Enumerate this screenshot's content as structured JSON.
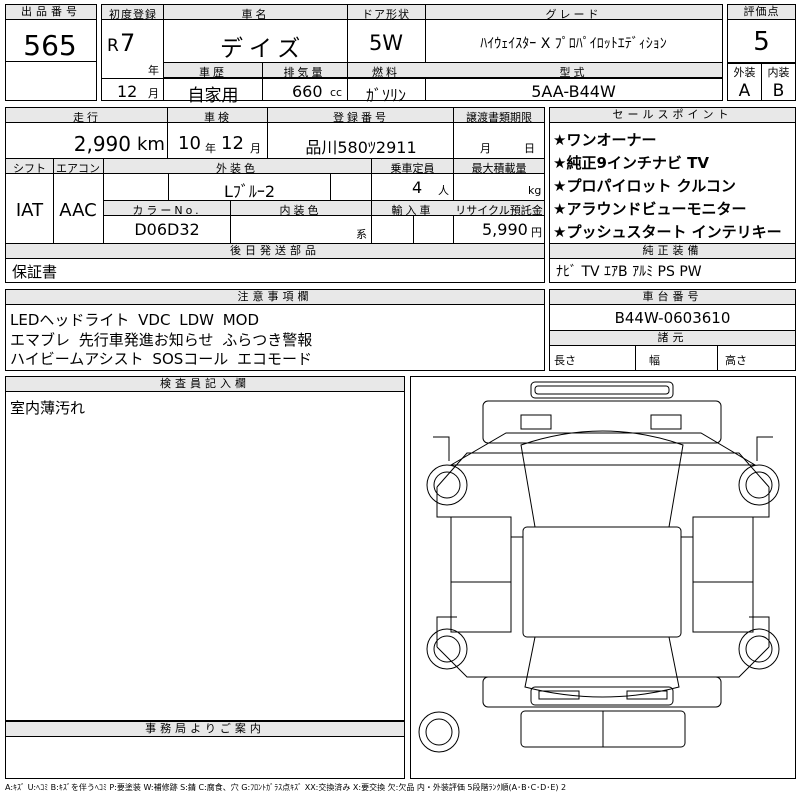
{
  "lot": {
    "label": "出品番号",
    "value": "565"
  },
  "first_reg": {
    "label": "初度登録",
    "era": "R",
    "year": "7",
    "year_unit": "年",
    "month": "12",
    "month_unit": "月"
  },
  "car_name": {
    "label": "車名",
    "value": "デイズ"
  },
  "door": {
    "label": "ドア形状",
    "value": "5W"
  },
  "grade": {
    "label": "グレード",
    "value": "ﾊｲｳｪｲｽﾀｰ X ﾌﾟﾛﾊﾟｲﾛｯﾄｴﾃﾞｨｼｮﾝ"
  },
  "score": {
    "label": "評価点",
    "value": "5"
  },
  "history": {
    "label": "車歴",
    "value": "自家用"
  },
  "displacement": {
    "label": "排気量",
    "value": "660",
    "unit": "cc"
  },
  "fuel": {
    "label": "燃料",
    "value": "ｶﾞｿﾘﾝ"
  },
  "model_code": {
    "label": "型式",
    "value": "5AA-B44W"
  },
  "exterior_score": {
    "label": "外装",
    "value": "A"
  },
  "interior_score": {
    "label": "内装",
    "value": "B"
  },
  "mileage": {
    "label": "走行",
    "value": "2,990",
    "unit": "km"
  },
  "inspection": {
    "label": "車検",
    "year": "10",
    "year_unit": "年",
    "month": "12",
    "month_unit": "月"
  },
  "plate": {
    "label": "登録番号",
    "value": "品川580ﾂ2911"
  },
  "transfer_deadline": {
    "label": "譲渡書類期限",
    "month_unit": "月",
    "day_unit": "日"
  },
  "shift": {
    "label": "シフト",
    "value": "IAT"
  },
  "aircon": {
    "label": "エアコン",
    "value": "AAC"
  },
  "exterior_color": {
    "label": "外装色",
    "value": "Lﾌﾞﾙｰ2"
  },
  "capacity": {
    "label": "乗車定員",
    "value": "4",
    "unit": "人"
  },
  "max_load": {
    "label": "最大積載量",
    "unit": "kg"
  },
  "color_no": {
    "label": "カラーNo.",
    "value": "D06D32"
  },
  "interior_color": {
    "label": "内装色",
    "unit": "系"
  },
  "import": {
    "label": "輸入車"
  },
  "recycle": {
    "label": "リサイクル預託金",
    "value": "5,990",
    "unit": "円"
  },
  "sales_points": {
    "label": "セールスポイント",
    "items": [
      "★ワンオーナー",
      "★純正9インチナビ TV",
      "★プロパイロット クルコン",
      "★アラウンドビューモニター",
      "★プッシュスタート インテリキー"
    ]
  },
  "later_parts": {
    "label": "後日発送部品",
    "value": "保証書"
  },
  "equipment": {
    "label": "純正装備",
    "value": "ﾅﾋﾞ TV ｴｱB ｱﾙﾐ PS PW"
  },
  "notes": {
    "label": "注意事項欄",
    "lines": [
      "LEDヘッドライト VDC LDW MOD",
      "エマブレ 先行車発進お知らせ ふらつき警報",
      "ハイビームアシスト SOSコール エコモード"
    ]
  },
  "chassis": {
    "label": "車台番号",
    "value": "B44W-0603610"
  },
  "specs": {
    "label": "諸元",
    "length": "長さ",
    "width": "幅",
    "height": "高さ"
  },
  "inspector": {
    "label": "検査員記入欄",
    "value": "室内薄汚れ"
  },
  "office": {
    "label": "事務局よりご案内"
  },
  "legend": "A:ｷｽﾞ U:ﾍｺﾐ B:ｷｽﾞを伴うﾍｺﾐ P:要塗装 W:補修跡 S:錆 C:腐食、穴 G:ﾌﾛﾝﾄｶﾞﾗｽ点ｷｽﾞ XX:交換済み X:要交換 欠:欠品 内・外装評価 5段階ﾗﾝｸ順(A･B･C･D･E) 2"
}
